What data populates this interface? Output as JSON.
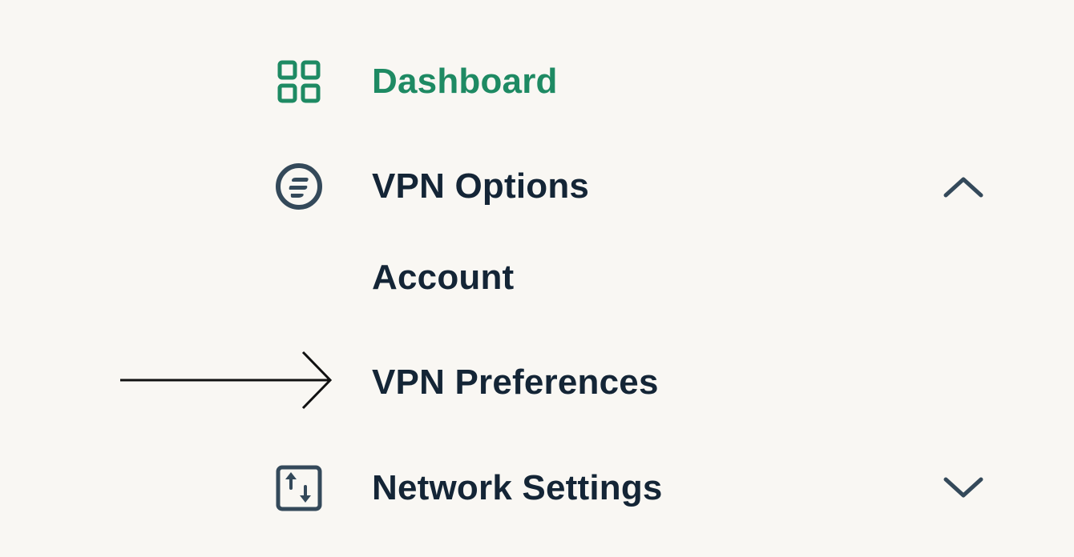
{
  "nav": {
    "dashboard": {
      "label": "Dashboard",
      "icon": "grid-icon",
      "active": true
    },
    "vpn_options": {
      "label": "VPN Options",
      "icon": "vpn-circle-icon",
      "expanded": true,
      "chevron": "chevron-up-icon",
      "children": [
        {
          "label": "Account"
        },
        {
          "label": "VPN Preferences",
          "highlighted": true
        }
      ]
    },
    "network_settings": {
      "label": "Network Settings",
      "icon": "transfer-arrows-icon",
      "expanded": false,
      "chevron": "chevron-down-icon"
    }
  },
  "annotation": {
    "icon": "pointer-arrow-icon"
  },
  "colors": {
    "background": "#f9f7f3",
    "active": "#1e8a63",
    "text": "#142536",
    "icon": "#34495a",
    "annotation": "#111111"
  }
}
